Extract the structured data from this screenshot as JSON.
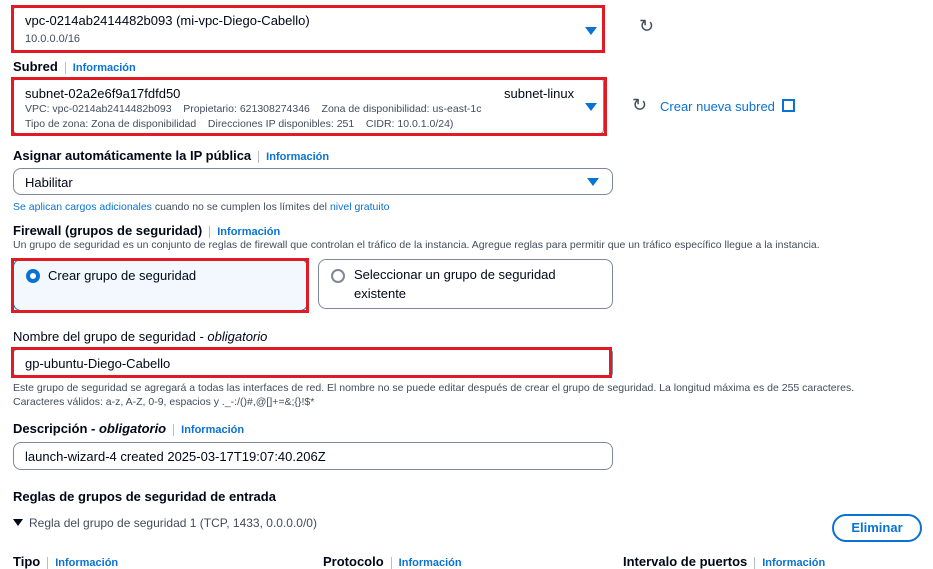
{
  "vpc": {
    "name": "vpc-0214ab2414482b093 (mi-vpc-Diego-Cabello)",
    "cidr": "10.0.0.0/16"
  },
  "subnet": {
    "label": "Subred",
    "info": "Información",
    "id": "subnet-02a2e6f9a17fdfd50",
    "name": "subnet-linux",
    "line2": "VPC: vpc-0214ab2414482b093    Propietario: 621308274346    Zona de disponibilidad: us-east-1c",
    "line3": "Tipo de zona: Zona de disponibilidad    Direcciones IP disponibles: 251    CIDR: 10.0.1.0/24)",
    "create_link": "Crear nueva subred"
  },
  "public_ip": {
    "label": "Asignar automáticamente la IP pública",
    "info": "Información",
    "value": "Habilitar",
    "note_link1": "Se aplican cargos adicionales",
    "note_mid": " cuando no se cumplen los límites del ",
    "note_link2": "nivel gratuito"
  },
  "firewall": {
    "label": "Firewall (grupos de seguridad)",
    "info": "Información",
    "desc": "Un grupo de seguridad es un conjunto de reglas de firewall que controlan el tráfico de la instancia. Agregue reglas para permitir que un tráfico específico llegue a la instancia.",
    "option_create": "Crear grupo de seguridad",
    "option_select_1": "Seleccionar un grupo de seguridad",
    "option_select_2": "existente"
  },
  "sg_name": {
    "label": "Nombre del grupo de seguridad - ",
    "label_italic": "obligatorio",
    "value": "gp-ubuntu-Diego-Cabello",
    "help1": "Este grupo de seguridad se agregará a todas las interfaces de red. El nombre no se puede editar después de crear el grupo de seguridad. La longitud máxima es de 255 caracteres.",
    "help2": "Caracteres válidos: a-z, A-Z, 0-9, espacios y ._-:/()#,@[]+=&;{}!$*"
  },
  "description": {
    "label": "Descripción - ",
    "label_italic": "obligatorio",
    "info": "Información",
    "value": "launch-wizard-4 created 2025-03-17T19:07:40.206Z"
  },
  "inbound": {
    "title": "Reglas de grupos de seguridad de entrada",
    "rule": "Regla del grupo de seguridad 1 (TCP, 1433, 0.0.0.0/0)",
    "remove_button": "Eliminar",
    "col_type": "Tipo",
    "col_protocol": "Protocolo",
    "col_ports": "Intervalo de puertos",
    "info": "Información"
  }
}
